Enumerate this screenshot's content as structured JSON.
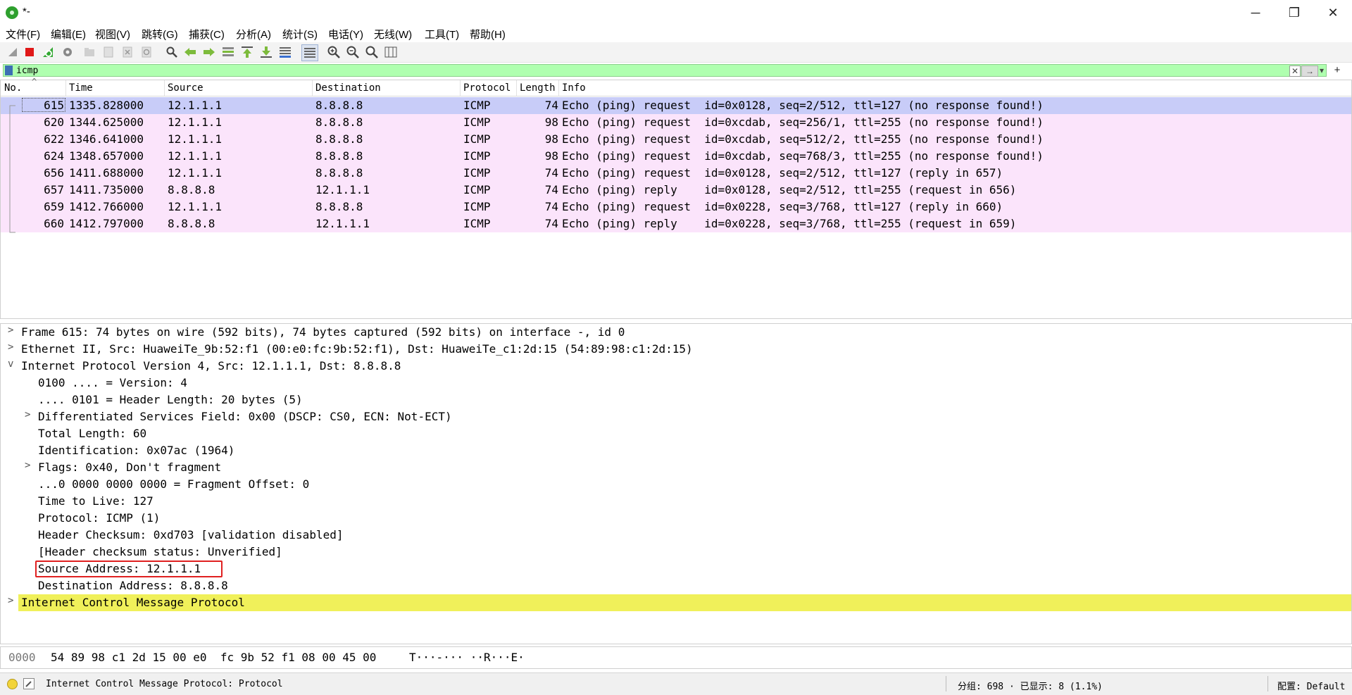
{
  "window": {
    "title": "*-",
    "minimize_glyph": "─",
    "maximize_glyph": "❐",
    "close_glyph": "✕"
  },
  "menu": [
    "文件(F)",
    "编辑(E)",
    "视图(V)",
    "跳转(G)",
    "捕获(C)",
    "分析(A)",
    "统计(S)",
    "电话(Y)",
    "无线(W)",
    "工具(T)",
    "帮助(H)"
  ],
  "toolbar": {
    "icons": [
      "shark-start-icon",
      "stop-capture-icon",
      "restart-capture-icon",
      "capture-options-icon",
      "open-file-icon",
      "save-file-icon",
      "close-file-icon",
      "reload-file-icon",
      "find-packet-icon",
      "go-back-icon",
      "go-forward-icon",
      "go-to-packet-icon",
      "go-first-icon",
      "go-last-icon",
      "autoscroll-icon",
      "colorize-icon",
      "zoom-in-icon",
      "zoom-out-icon",
      "zoom-normal-icon",
      "resize-columns-icon"
    ]
  },
  "filter": {
    "value": "icmp",
    "clear_glyph": "✕",
    "apply_glyph": "→",
    "dropdown_glyph": "▾",
    "add_glyph": "+",
    "bg_color": "#afffaf"
  },
  "packet_list": {
    "columns": [
      "No.",
      "Time",
      "Source",
      "Destination",
      "Protocol",
      "Length",
      "Info"
    ],
    "sort_glyph": "^",
    "selected_color": "#c8ccf8",
    "row_color": "#fbe4fb",
    "rows": [
      {
        "no": "615",
        "time": "1335.828000",
        "src": "12.1.1.1",
        "dst": "8.8.8.8",
        "proto": "ICMP",
        "len": "74",
        "info": "Echo (ping) request  id=0x0128, seq=2/512, ttl=127 (no response found!)"
      },
      {
        "no": "620",
        "time": "1344.625000",
        "src": "12.1.1.1",
        "dst": "8.8.8.8",
        "proto": "ICMP",
        "len": "98",
        "info": "Echo (ping) request  id=0xcdab, seq=256/1, ttl=255 (no response found!)"
      },
      {
        "no": "622",
        "time": "1346.641000",
        "src": "12.1.1.1",
        "dst": "8.8.8.8",
        "proto": "ICMP",
        "len": "98",
        "info": "Echo (ping) request  id=0xcdab, seq=512/2, ttl=255 (no response found!)"
      },
      {
        "no": "624",
        "time": "1348.657000",
        "src": "12.1.1.1",
        "dst": "8.8.8.8",
        "proto": "ICMP",
        "len": "98",
        "info": "Echo (ping) request  id=0xcdab, seq=768/3, ttl=255 (no response found!)"
      },
      {
        "no": "656",
        "time": "1411.688000",
        "src": "12.1.1.1",
        "dst": "8.8.8.8",
        "proto": "ICMP",
        "len": "74",
        "info": "Echo (ping) request  id=0x0128, seq=2/512, ttl=127 (reply in 657)"
      },
      {
        "no": "657",
        "time": "1411.735000",
        "src": "8.8.8.8",
        "dst": "12.1.1.1",
        "proto": "ICMP",
        "len": "74",
        "info": "Echo (ping) reply    id=0x0128, seq=2/512, ttl=255 (request in 656)"
      },
      {
        "no": "659",
        "time": "1412.766000",
        "src": "12.1.1.1",
        "dst": "8.8.8.8",
        "proto": "ICMP",
        "len": "74",
        "info": "Echo (ping) request  id=0x0228, seq=3/768, ttl=127 (reply in 660)"
      },
      {
        "no": "660",
        "time": "1412.797000",
        "src": "8.8.8.8",
        "dst": "12.1.1.1",
        "proto": "ICMP",
        "len": "74",
        "info": "Echo (ping) reply    id=0x0228, seq=3/768, ttl=255 (request in 659)"
      }
    ]
  },
  "details": {
    "collapsed_glyph": ">",
    "expanded_glyph": "v",
    "highlight_color": "#f0f05a",
    "box_color": "#e02020",
    "rows": [
      {
        "text": "Frame 615: 74 bytes on wire (592 bits), 74 bytes captured (592 bits) on interface -, id 0",
        "expander": "collapsed"
      },
      {
        "text": "Ethernet II, Src: HuaweiTe_9b:52:f1 (00:e0:fc:9b:52:f1), Dst: HuaweiTe_c1:2d:15 (54:89:98:c1:2d:15)",
        "expander": "collapsed"
      },
      {
        "text": "Internet Protocol Version 4, Src: 12.1.1.1, Dst: 8.8.8.8",
        "expander": "expanded"
      },
      {
        "text": "0100 .... = Version: 4",
        "expander": "none"
      },
      {
        "text": ".... 0101 = Header Length: 20 bytes (5)",
        "expander": "none"
      },
      {
        "text": "Differentiated Services Field: 0x00 (DSCP: CS0, ECN: Not-ECT)",
        "expander": "collapsed"
      },
      {
        "text": "Total Length: 60",
        "expander": "none"
      },
      {
        "text": "Identification: 0x07ac (1964)",
        "expander": "none"
      },
      {
        "text": "Flags: 0x40, Don't fragment",
        "expander": "collapsed"
      },
      {
        "text": "...0 0000 0000 0000 = Fragment Offset: 0",
        "expander": "none"
      },
      {
        "text": "Time to Live: 127",
        "expander": "none"
      },
      {
        "text": "Protocol: ICMP (1)",
        "expander": "none"
      },
      {
        "text": "Header Checksum: 0xd703 [validation disabled]",
        "expander": "none"
      },
      {
        "text": "[Header checksum status: Unverified]",
        "expander": "none"
      },
      {
        "text": "Source Address: 12.1.1.1",
        "expander": "none"
      },
      {
        "text": "Destination Address: 8.8.8.8",
        "expander": "none"
      },
      {
        "text": "Internet Control Message Protocol",
        "expander": "collapsed"
      }
    ]
  },
  "bytes": {
    "offset": "0000",
    "hex": "54 89 98 c1 2d 15 00 e0  fc 9b 52 f1 08 00 45 00",
    "ascii": "T···-··· ··R···E·"
  },
  "status": {
    "field_info": "Internet Control Message Protocol: Protocol",
    "packets": "分组: 698 · 已显示: 8 (1.1%)",
    "profile": "配置: Default"
  }
}
